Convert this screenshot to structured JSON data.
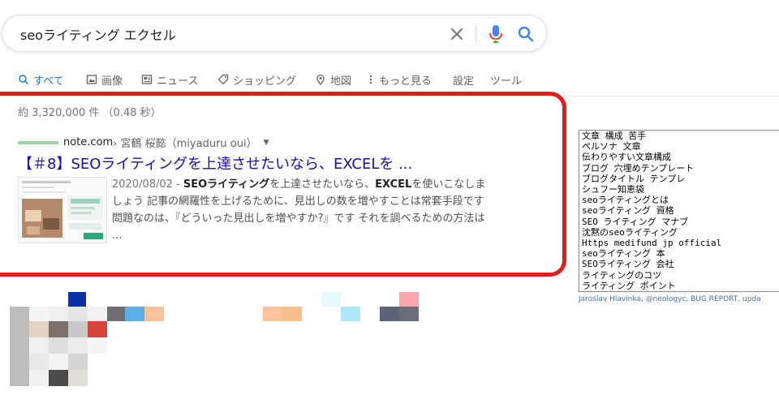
{
  "search": {
    "query": "seoライティング エクセル",
    "clear_icon": "close-icon",
    "mic_icon": "microphone-icon",
    "search_icon": "search-icon"
  },
  "tabs": [
    {
      "label": "すべて",
      "icon": "search-icon",
      "active": true
    },
    {
      "label": "画像",
      "icon": "image-icon",
      "active": false
    },
    {
      "label": "ニュース",
      "icon": "news-icon",
      "active": false
    },
    {
      "label": "ショッピング",
      "icon": "tag-icon",
      "active": false
    },
    {
      "label": "地図",
      "icon": "map-pin-icon",
      "active": false
    },
    {
      "label": "もっと見る",
      "icon": "more-vert-icon",
      "active": false
    },
    {
      "label": "設定",
      "icon": "",
      "active": false
    },
    {
      "label": "ツール",
      "icon": "",
      "active": false
    }
  ],
  "stats": "約 3,320,000 件 （0.48 秒）",
  "result": {
    "host": "note.com",
    "crumb": " › 宮鶴 桜懿（miyaduru oui）",
    "title": "【＃8】SEOライティングを上達させたいなら、EXCELを ...",
    "date": "2020/08/02",
    "snippet_parts": [
      {
        "text": "2020/08/02 - ",
        "bold": false
      },
      {
        "text": "SEOライティング",
        "bold": true
      },
      {
        "text": "を上達させたいなら、",
        "bold": false
      },
      {
        "text": "EXCEL",
        "bold": true
      },
      {
        "text": "を使いこなしましょう 記事の網羅性を上げるために、見出しの数を増やすことは常套手段です 問題なのは、『どういった見出しを増やすか?』です それを調べるための方法は ...",
        "bold": false
      }
    ]
  },
  "keyword_panel": {
    "items": [
      "文章 構成 苦手",
      "ペルソナ 文章",
      "伝わりやすい文章構成",
      "ブログ 穴埋めテンプレート",
      "ブログタイトル テンプレ",
      "シュフー知恵袋",
      "seoライティングとは",
      "seoライティング 資格",
      "SEO ライティング マナブ",
      "沈黙のseoライティング",
      "Https medifund jp official",
      "seoライティング 本",
      "SEOライティング 会社",
      "ライティングのコツ",
      "ライティング ポイント"
    ],
    "credit": "Jaroslav Hlavinka, @neologyc, BUG REPORT, upda"
  },
  "colors": {
    "link": "#1a0dab",
    "accent": "#1a73e8",
    "highlight": "#e41c1c"
  }
}
